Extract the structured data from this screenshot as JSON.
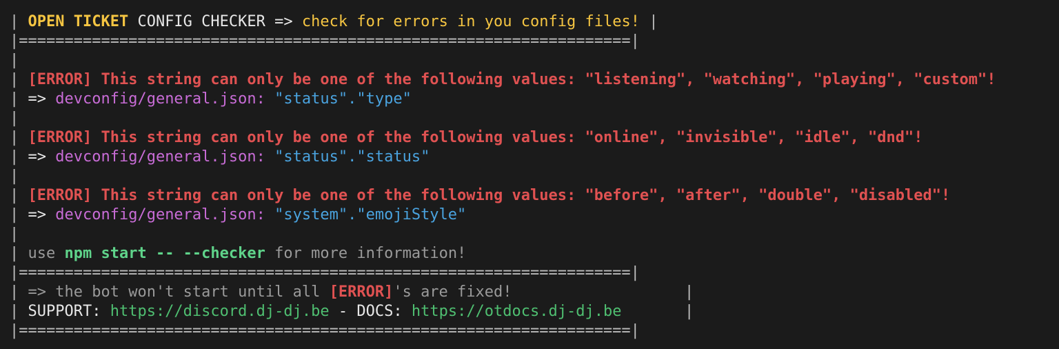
{
  "pipe": "|",
  "separator": "|===================================================================|",
  "header": {
    "title_bold": "OPEN TICKET",
    "title_rest": "CONFIG CHECKER",
    "arrow": "=>",
    "subtitle": "check for errors in you config files!"
  },
  "errors": [
    {
      "label": "[ERROR]",
      "message": "This string can only be one of the following values: \"listening\", \"watching\", \"playing\", \"custom\"!",
      "arrow": "=>",
      "file": "devconfig/general.json:",
      "path": "\"status\".\"type\""
    },
    {
      "label": "[ERROR]",
      "message": "This string can only be one of the following values: \"online\", \"invisible\", \"idle\", \"dnd\"!",
      "arrow": "=>",
      "file": "devconfig/general.json:",
      "path": "\"status\".\"status\""
    },
    {
      "label": "[ERROR]",
      "message": "This string can only be one of the following values: \"before\", \"after\", \"double\", \"disabled\"!",
      "arrow": "=>",
      "file": "devconfig/general.json:",
      "path": "\"system\".\"emojiStyle\""
    }
  ],
  "hint": {
    "prefix": "use",
    "command": "npm start -- --checker",
    "suffix": "for more information!"
  },
  "footer": {
    "arrow": "=>",
    "notice_pre": "the bot won't start until all",
    "notice_error": "[ERROR]",
    "notice_post": "'s are fixed!",
    "support_label": "SUPPORT:",
    "support_url": "https://discord.dj-dj.be",
    "dash": "-",
    "docs_label": "DOCS:",
    "docs_url": "https://otdocs.dj-dj.be"
  },
  "colors": {
    "background": "#1b1b1b",
    "error_red": "#e05252",
    "header_yellow": "#f5c542",
    "file_magenta": "#c86cd6",
    "path_blue": "#4aa3df",
    "url_green": "#4fbf71"
  }
}
